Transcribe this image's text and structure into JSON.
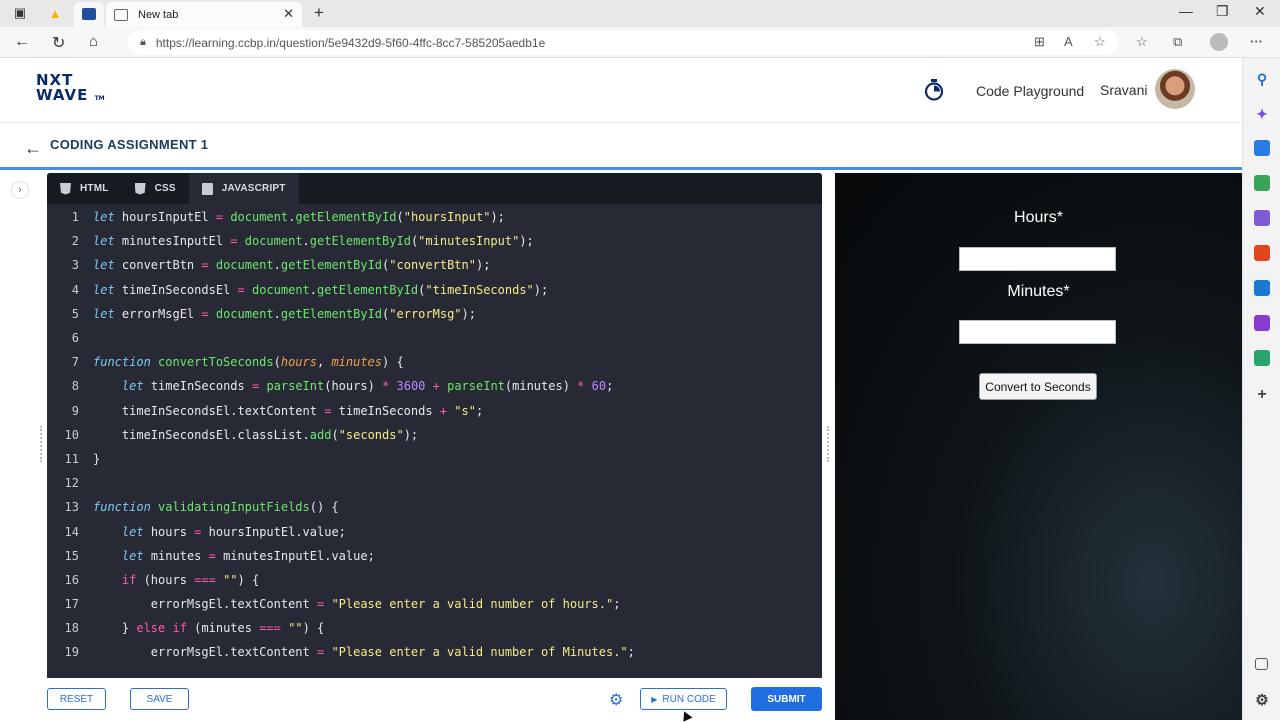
{
  "browser": {
    "tabs": [
      {
        "label": ""
      },
      {
        "label": "New tab"
      }
    ],
    "url": "https://learning.ccbp.in/question/5e9432d9-5f60-4ffc-8cc7-585205aedb1e"
  },
  "header": {
    "logo_line1": "NXT",
    "logo_line2": "WAVE",
    "logo_tm": "TM",
    "code_playground": "Code Playground",
    "username": "Sravani"
  },
  "assignment": {
    "title": "CODING ASSIGNMENT 1"
  },
  "editor": {
    "tabs": [
      "HTML",
      "CSS",
      "JAVASCRIPT"
    ],
    "active_tab": "JAVASCRIPT",
    "lines": [
      {
        "n": "1",
        "t": [
          [
            "kw",
            "let"
          ],
          [
            "id",
            " hoursInputEl "
          ],
          [
            "op",
            "="
          ],
          [
            "id",
            " "
          ],
          [
            "fn",
            "document"
          ],
          [
            "id",
            "."
          ],
          [
            "fn",
            "getElementById"
          ],
          [
            "id",
            "("
          ],
          [
            "str",
            "\"hoursInput\""
          ],
          [
            "id",
            ");"
          ]
        ]
      },
      {
        "n": "2",
        "t": [
          [
            "kw",
            "let"
          ],
          [
            "id",
            " minutesInputEl "
          ],
          [
            "op",
            "="
          ],
          [
            "id",
            " "
          ],
          [
            "fn",
            "document"
          ],
          [
            "id",
            "."
          ],
          [
            "fn",
            "getElementById"
          ],
          [
            "id",
            "("
          ],
          [
            "str",
            "\"minutesInput\""
          ],
          [
            "id",
            ");"
          ]
        ]
      },
      {
        "n": "3",
        "t": [
          [
            "kw",
            "let"
          ],
          [
            "id",
            " convertBtn "
          ],
          [
            "op",
            "="
          ],
          [
            "id",
            " "
          ],
          [
            "fn",
            "document"
          ],
          [
            "id",
            "."
          ],
          [
            "fn",
            "getElementById"
          ],
          [
            "id",
            "("
          ],
          [
            "str",
            "\"convertBtn\""
          ],
          [
            "id",
            ");"
          ]
        ]
      },
      {
        "n": "4",
        "t": [
          [
            "kw",
            "let"
          ],
          [
            "id",
            " timeInSecondsEl "
          ],
          [
            "op",
            "="
          ],
          [
            "id",
            " "
          ],
          [
            "fn",
            "document"
          ],
          [
            "id",
            "."
          ],
          [
            "fn",
            "getElementById"
          ],
          [
            "id",
            "("
          ],
          [
            "str",
            "\"timeInSeconds\""
          ],
          [
            "id",
            ");"
          ]
        ]
      },
      {
        "n": "5",
        "t": [
          [
            "kw",
            "let"
          ],
          [
            "id",
            " errorMsgEl "
          ],
          [
            "op",
            "="
          ],
          [
            "id",
            " "
          ],
          [
            "fn",
            "document"
          ],
          [
            "id",
            "."
          ],
          [
            "fn",
            "getElementById"
          ],
          [
            "id",
            "("
          ],
          [
            "str",
            "\"errorMsg\""
          ],
          [
            "id",
            ");"
          ]
        ]
      },
      {
        "n": "6",
        "t": []
      },
      {
        "n": "7",
        "t": [
          [
            "kw",
            "function"
          ],
          [
            "id",
            " "
          ],
          [
            "fn",
            "convertToSeconds"
          ],
          [
            "id",
            "("
          ],
          [
            "pm",
            "hours"
          ],
          [
            "id",
            ", "
          ],
          [
            "pm",
            "minutes"
          ],
          [
            "id",
            ") {"
          ]
        ]
      },
      {
        "n": "8",
        "t": [
          [
            "id",
            "    "
          ],
          [
            "kw",
            "let"
          ],
          [
            "id",
            " timeInSeconds "
          ],
          [
            "op",
            "="
          ],
          [
            "id",
            " "
          ],
          [
            "fn",
            "parseInt"
          ],
          [
            "id",
            "(hours) "
          ],
          [
            "op",
            "*"
          ],
          [
            "id",
            " "
          ],
          [
            "num",
            "3600"
          ],
          [
            "id",
            " "
          ],
          [
            "op",
            "+"
          ],
          [
            "id",
            " "
          ],
          [
            "fn",
            "parseInt"
          ],
          [
            "id",
            "(minutes) "
          ],
          [
            "op",
            "*"
          ],
          [
            "id",
            " "
          ],
          [
            "num",
            "60"
          ],
          [
            "id",
            ";"
          ]
        ]
      },
      {
        "n": "9",
        "t": [
          [
            "id",
            "    timeInSecondsEl.textContent "
          ],
          [
            "op",
            "="
          ],
          [
            "id",
            " timeInSeconds "
          ],
          [
            "op",
            "+"
          ],
          [
            "id",
            " "
          ],
          [
            "str",
            "\"s\""
          ],
          [
            "id",
            ";"
          ]
        ]
      },
      {
        "n": "10",
        "t": [
          [
            "id",
            "    timeInSecondsEl.classList."
          ],
          [
            "fn",
            "add"
          ],
          [
            "id",
            "("
          ],
          [
            "str",
            "\"seconds\""
          ],
          [
            "id",
            ");"
          ]
        ]
      },
      {
        "n": "11",
        "t": [
          [
            "id",
            "}"
          ]
        ]
      },
      {
        "n": "12",
        "t": []
      },
      {
        "n": "13",
        "t": [
          [
            "kw",
            "function"
          ],
          [
            "id",
            " "
          ],
          [
            "fn",
            "validatingInputFields"
          ],
          [
            "id",
            "() {"
          ]
        ]
      },
      {
        "n": "14",
        "t": [
          [
            "id",
            "    "
          ],
          [
            "kw",
            "let"
          ],
          [
            "id",
            " hours "
          ],
          [
            "op",
            "="
          ],
          [
            "id",
            " hoursInputEl.value;"
          ]
        ]
      },
      {
        "n": "15",
        "t": [
          [
            "id",
            "    "
          ],
          [
            "kw",
            "let"
          ],
          [
            "id",
            " minutes "
          ],
          [
            "op",
            "="
          ],
          [
            "id",
            " minutesInputEl.value;"
          ]
        ]
      },
      {
        "n": "16",
        "t": [
          [
            "id",
            "    "
          ],
          [
            "ctl",
            "if"
          ],
          [
            "id",
            " (hours "
          ],
          [
            "op",
            "==="
          ],
          [
            "id",
            " "
          ],
          [
            "str",
            "\"\""
          ],
          [
            "id",
            ") {"
          ]
        ]
      },
      {
        "n": "17",
        "t": [
          [
            "id",
            "        errorMsgEl.textContent "
          ],
          [
            "op",
            "="
          ],
          [
            "id",
            " "
          ],
          [
            "str",
            "\"Please enter a valid number of hours.\""
          ],
          [
            "id",
            ";"
          ]
        ]
      },
      {
        "n": "18",
        "t": [
          [
            "id",
            "    } "
          ],
          [
            "ctl",
            "else"
          ],
          [
            "id",
            " "
          ],
          [
            "ctl",
            "if"
          ],
          [
            "id",
            " (minutes "
          ],
          [
            "op",
            "==="
          ],
          [
            "id",
            " "
          ],
          [
            "str",
            "\"\""
          ],
          [
            "id",
            ") {"
          ]
        ]
      },
      {
        "n": "19",
        "t": [
          [
            "id",
            "        errorMsgEl.textContent "
          ],
          [
            "op",
            "="
          ],
          [
            "id",
            " "
          ],
          [
            "str",
            "\"Please enter a valid number of Minutes.\""
          ],
          [
            "id",
            ";"
          ]
        ]
      }
    ]
  },
  "actions": {
    "reset": "RESET",
    "save": "SAVE",
    "run": "RUN CODE",
    "submit": "SUBMIT"
  },
  "preview": {
    "hours_label": "Hours*",
    "minutes_label": "Minutes*",
    "hours_value": "",
    "minutes_value": "",
    "convert_button": "Convert to Seconds"
  }
}
